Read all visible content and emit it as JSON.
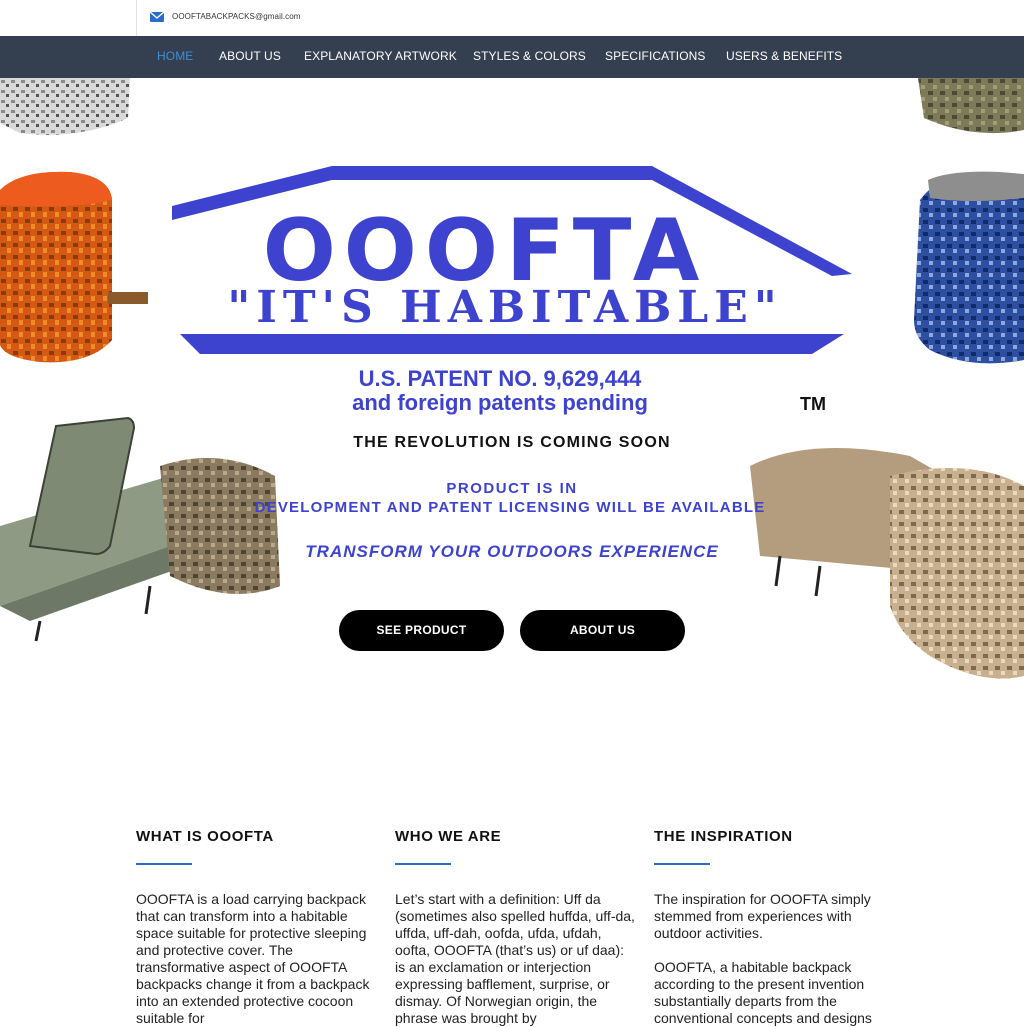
{
  "topbar": {
    "email": "OOOFTABACKPACKS@gmail.com",
    "icon": "envelope-icon"
  },
  "nav": {
    "items": [
      {
        "label": "HOME",
        "active": true
      },
      {
        "label": "ABOUT US"
      },
      {
        "label": "EXPLANATORY ARTWORK"
      },
      {
        "label": "STYLES & COLORS"
      },
      {
        "label": "SPECIFICATIONS"
      },
      {
        "label": "USERS & BENEFITS"
      }
    ],
    "active_color": "#3d8fd6"
  },
  "hero": {
    "logo_main": "OOOFTA",
    "logo_tagline": "\"IT'S HABITABLE\"",
    "patent_line1": "U.S. PATENT NO. 9,629,444",
    "patent_line2": "and foreign patents pending",
    "trademark": "TM",
    "revolution": "THE REVOLUTION IS COMING SOON",
    "development_line1": "PRODUCT IS IN",
    "development_line2": "DEVELOPMENT AND PATENT LICENSING WILL BE AVAILABLE",
    "transform": "TRANSFORM YOUR OUTDOORS EXPERIENCE",
    "brand_color": "#3d43cf"
  },
  "buttons": {
    "see_product": "SEE PRODUCT",
    "about_us": "ABOUT US"
  },
  "columns": [
    {
      "heading": "WHAT IS OOOFTA",
      "paragraphs": [
        "OOOFTA is a load carrying backpack that can transform into a habitable space suitable for protective sleeping and protective cover. The transformative aspect of OOOFTA backpacks change it from a backpack into an extended protective cocoon suitable for"
      ]
    },
    {
      "heading": "WHO WE ARE",
      "paragraphs": [
        "Let’s start with a definition: Uff da (sometimes also spelled huffda, uff-da, uffda, uff-dah, oofda, ufda, ufdah, oofta, OOOFTA (that’s us) or uf daa): is an exclamation or interjection expressing bafflement, surprise, or dismay. Of Norwegian origin, the phrase was brought by"
      ]
    },
    {
      "heading": "THE INSPIRATION",
      "paragraphs": [
        "The inspiration for OOOFTA simply stemmed from experiences with outdoor activities.",
        "OOOFTA, a habitable backpack according to the present invention substantially departs from the conventional concepts and designs"
      ]
    }
  ]
}
